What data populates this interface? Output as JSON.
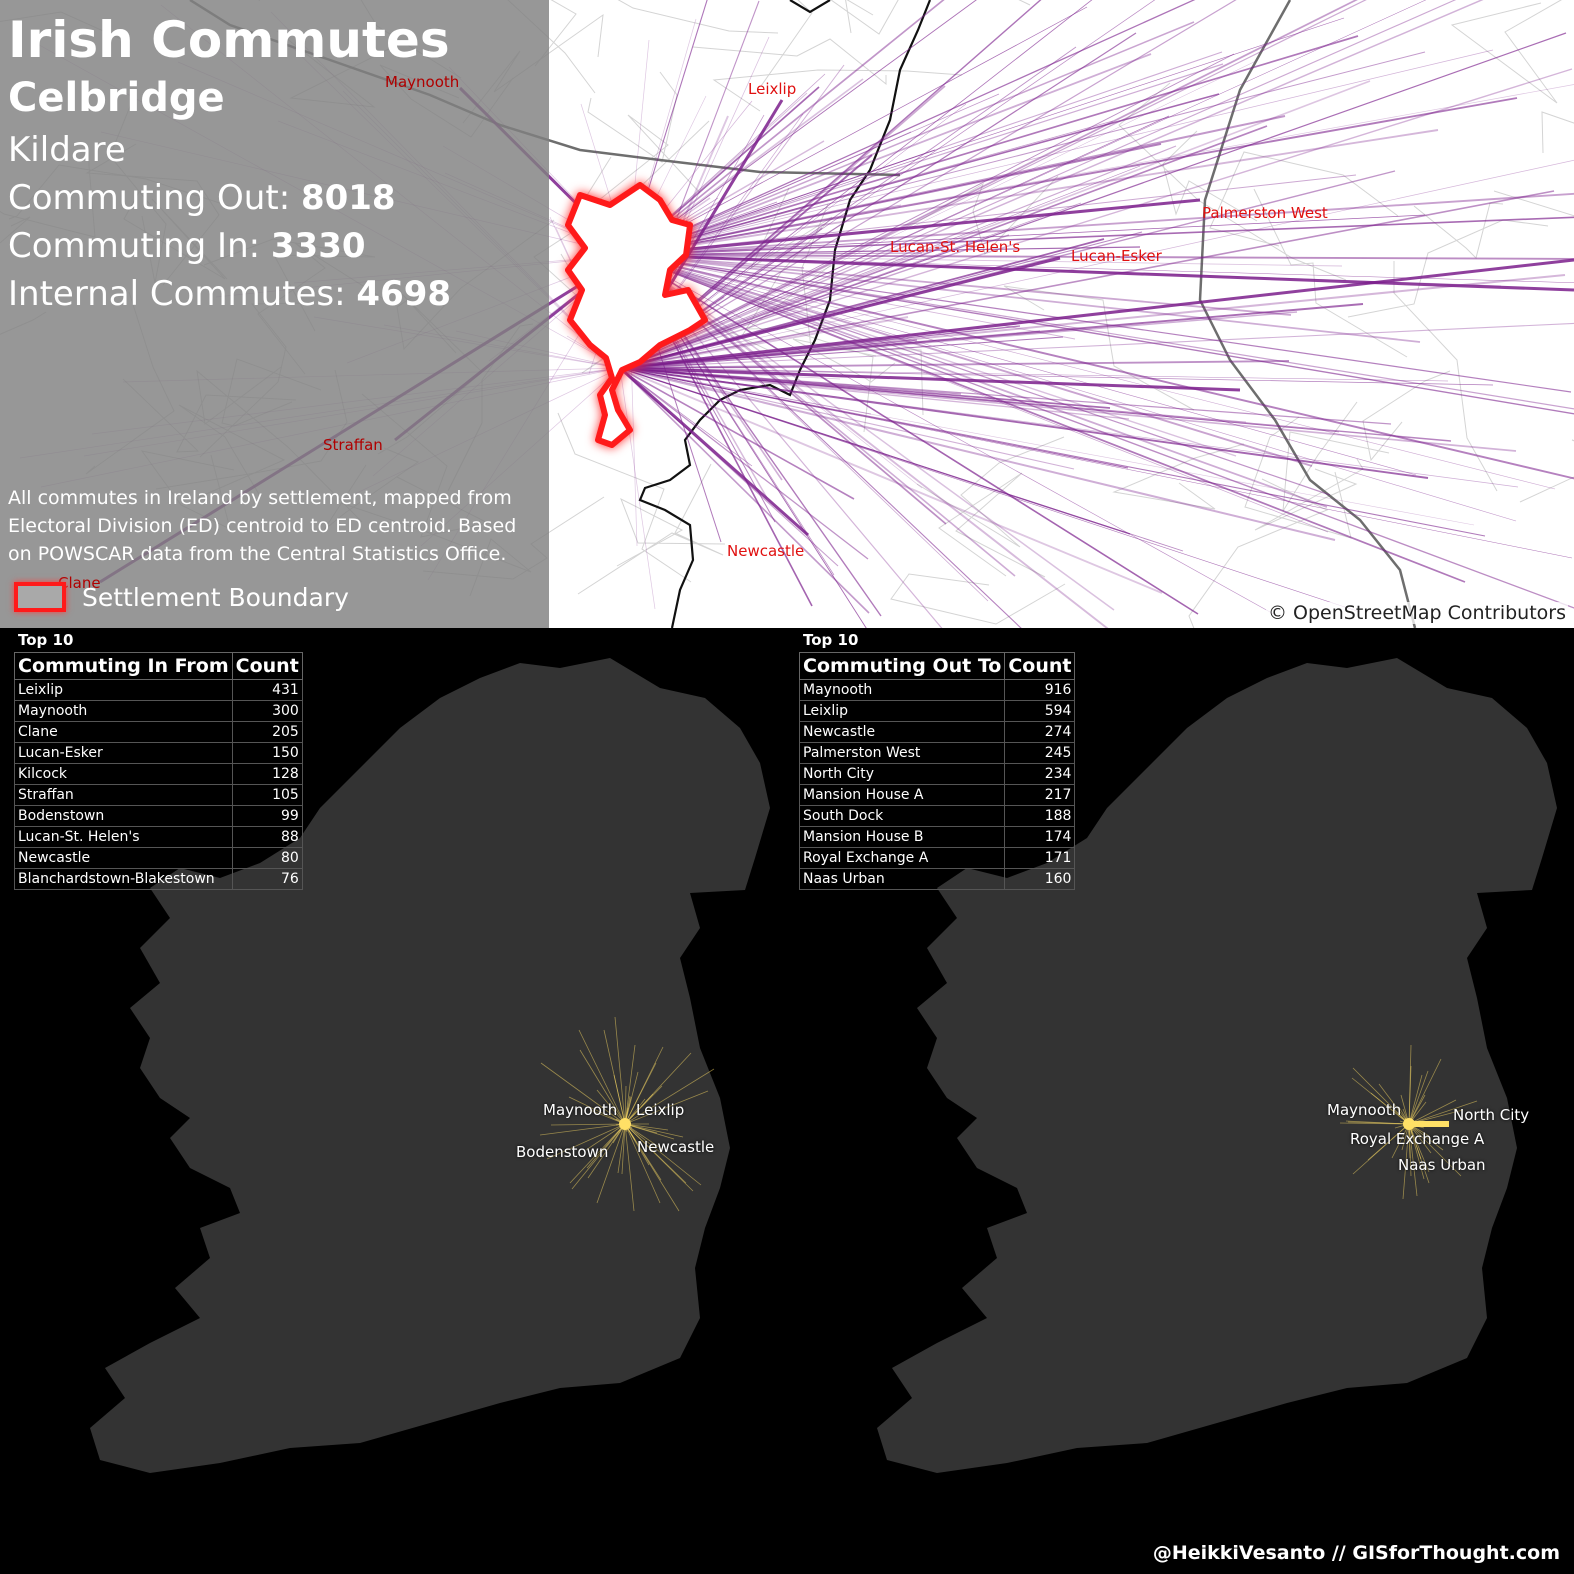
{
  "title": "Irish Commutes",
  "settlement": "Celbridge",
  "county": "Kildare",
  "stats": {
    "out_label": "Commuting Out: ",
    "out_value": "8018",
    "in_label": "Commuting In: ",
    "in_value": "3330",
    "internal_label": "Internal Commutes: ",
    "internal_value": "4698"
  },
  "description": "All commutes in Ireland by settlement, mapped from Electoral Division (ED) centroid to ED centroid. Based on POWSCAR data from the Central Statistics Office.",
  "legend": {
    "label": "Settlement Boundary",
    "border_color": "#ff1a1a",
    "fill_color": "#a9a9a9"
  },
  "map_places": [
    "Maynooth",
    "Leixlip",
    "Palmerston West",
    "Lucan-St. Helen's",
    "Lucan-Esker",
    "Straffan",
    "Newcastle",
    "Clane"
  ],
  "attribution": "© OpenStreetMap Contributors",
  "line_color": "#7b1f8c",
  "glow_color": "#ffe066",
  "in_table": {
    "top_label": "Top 10",
    "header_name": "Commuting In From",
    "header_count": "Count",
    "rows": [
      {
        "name": "Leixlip",
        "count": "431"
      },
      {
        "name": "Maynooth",
        "count": "300"
      },
      {
        "name": "Clane",
        "count": "205"
      },
      {
        "name": "Lucan-Esker",
        "count": "150"
      },
      {
        "name": "Kilcock",
        "count": "128"
      },
      {
        "name": "Straffan",
        "count": "105"
      },
      {
        "name": "Bodenstown",
        "count": "99"
      },
      {
        "name": "Lucan-St. Helen's",
        "count": "88"
      },
      {
        "name": "Newcastle",
        "count": "80"
      },
      {
        "name": "Blanchardstown-Blakestown",
        "count": "76"
      }
    ],
    "map_labels": [
      "Maynooth",
      "Leixlip",
      "Bodenstown",
      "Newcastle"
    ]
  },
  "out_table": {
    "top_label": "Top 10",
    "header_name": "Commuting Out To",
    "header_count": "Count",
    "rows": [
      {
        "name": "Maynooth",
        "count": "916"
      },
      {
        "name": "Leixlip",
        "count": "594"
      },
      {
        "name": "Newcastle",
        "count": "274"
      },
      {
        "name": "Palmerston West",
        "count": "245"
      },
      {
        "name": "North City",
        "count": "234"
      },
      {
        "name": "Mansion House A",
        "count": "217"
      },
      {
        "name": "South Dock",
        "count": "188"
      },
      {
        "name": "Mansion House B",
        "count": "174"
      },
      {
        "name": "Royal Exchange A",
        "count": "171"
      },
      {
        "name": "Naas Urban",
        "count": "160"
      }
    ],
    "map_labels": [
      "Maynooth",
      "North City",
      "Royal Exchange A",
      "Naas Urban"
    ]
  },
  "credit": "@HeikkiVesanto // GISforThought.com"
}
